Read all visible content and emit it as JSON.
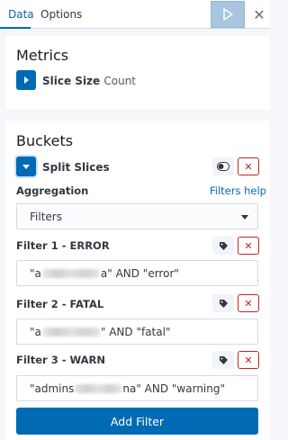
{
  "tabs": [
    {
      "label": "Data",
      "active": true
    },
    {
      "label": "Options",
      "active": false
    }
  ],
  "metrics": {
    "title": "Metrics",
    "agg_label": "Slice Size",
    "agg_value": "Count"
  },
  "buckets": {
    "title": "Buckets",
    "agg_label": "Split Slices",
    "aggregation_label": "Aggregation",
    "help_link": "Filters help",
    "selected_aggregation": "Filters",
    "filters": [
      {
        "label": "Filter 1 - ERROR",
        "query_prefix": "\"a",
        "query_suffix": "a\" AND \"error\""
      },
      {
        "label": "Filter 2 - FATAL",
        "query_prefix": "\"a",
        "query_suffix": "\" AND \"fatal\""
      },
      {
        "label": "Filter 3 - WARN",
        "query_prefix": "\"admins",
        "query_suffix": "na\" AND \"warning\""
      }
    ],
    "add_filter_label": "Add Filter"
  },
  "colors": {
    "accent": "#006bb4",
    "danger": "#bd271e",
    "background": "#f5f7fa"
  },
  "icons": [
    "play-icon",
    "close-icon",
    "chevron-right-icon",
    "chevron-down-icon",
    "toggle-icon",
    "remove-icon",
    "tag-icon",
    "select-caret-icon"
  ]
}
